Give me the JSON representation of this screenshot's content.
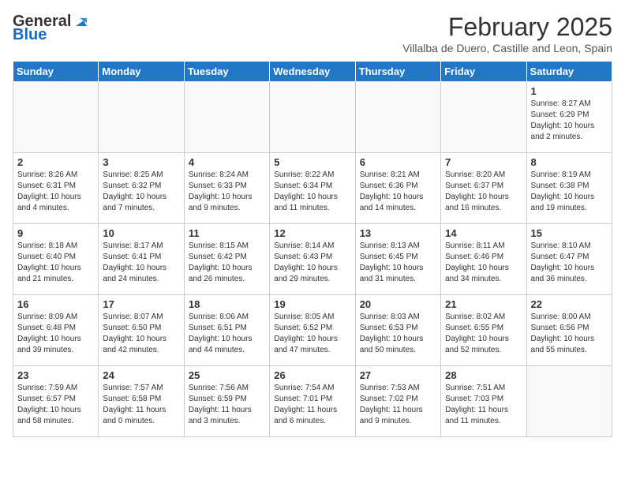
{
  "logo": {
    "general": "General",
    "blue": "Blue"
  },
  "header": {
    "title": "February 2025",
    "subtitle": "Villalba de Duero, Castille and Leon, Spain"
  },
  "weekdays": [
    "Sunday",
    "Monday",
    "Tuesday",
    "Wednesday",
    "Thursday",
    "Friday",
    "Saturday"
  ],
  "weeks": [
    [
      {
        "day": "",
        "info": ""
      },
      {
        "day": "",
        "info": ""
      },
      {
        "day": "",
        "info": ""
      },
      {
        "day": "",
        "info": ""
      },
      {
        "day": "",
        "info": ""
      },
      {
        "day": "",
        "info": ""
      },
      {
        "day": "1",
        "info": "Sunrise: 8:27 AM\nSunset: 6:29 PM\nDaylight: 10 hours\nand 2 minutes."
      }
    ],
    [
      {
        "day": "2",
        "info": "Sunrise: 8:26 AM\nSunset: 6:31 PM\nDaylight: 10 hours\nand 4 minutes."
      },
      {
        "day": "3",
        "info": "Sunrise: 8:25 AM\nSunset: 6:32 PM\nDaylight: 10 hours\nand 7 minutes."
      },
      {
        "day": "4",
        "info": "Sunrise: 8:24 AM\nSunset: 6:33 PM\nDaylight: 10 hours\nand 9 minutes."
      },
      {
        "day": "5",
        "info": "Sunrise: 8:22 AM\nSunset: 6:34 PM\nDaylight: 10 hours\nand 11 minutes."
      },
      {
        "day": "6",
        "info": "Sunrise: 8:21 AM\nSunset: 6:36 PM\nDaylight: 10 hours\nand 14 minutes."
      },
      {
        "day": "7",
        "info": "Sunrise: 8:20 AM\nSunset: 6:37 PM\nDaylight: 10 hours\nand 16 minutes."
      },
      {
        "day": "8",
        "info": "Sunrise: 8:19 AM\nSunset: 6:38 PM\nDaylight: 10 hours\nand 19 minutes."
      }
    ],
    [
      {
        "day": "9",
        "info": "Sunrise: 8:18 AM\nSunset: 6:40 PM\nDaylight: 10 hours\nand 21 minutes."
      },
      {
        "day": "10",
        "info": "Sunrise: 8:17 AM\nSunset: 6:41 PM\nDaylight: 10 hours\nand 24 minutes."
      },
      {
        "day": "11",
        "info": "Sunrise: 8:15 AM\nSunset: 6:42 PM\nDaylight: 10 hours\nand 26 minutes."
      },
      {
        "day": "12",
        "info": "Sunrise: 8:14 AM\nSunset: 6:43 PM\nDaylight: 10 hours\nand 29 minutes."
      },
      {
        "day": "13",
        "info": "Sunrise: 8:13 AM\nSunset: 6:45 PM\nDaylight: 10 hours\nand 31 minutes."
      },
      {
        "day": "14",
        "info": "Sunrise: 8:11 AM\nSunset: 6:46 PM\nDaylight: 10 hours\nand 34 minutes."
      },
      {
        "day": "15",
        "info": "Sunrise: 8:10 AM\nSunset: 6:47 PM\nDaylight: 10 hours\nand 36 minutes."
      }
    ],
    [
      {
        "day": "16",
        "info": "Sunrise: 8:09 AM\nSunset: 6:48 PM\nDaylight: 10 hours\nand 39 minutes."
      },
      {
        "day": "17",
        "info": "Sunrise: 8:07 AM\nSunset: 6:50 PM\nDaylight: 10 hours\nand 42 minutes."
      },
      {
        "day": "18",
        "info": "Sunrise: 8:06 AM\nSunset: 6:51 PM\nDaylight: 10 hours\nand 44 minutes."
      },
      {
        "day": "19",
        "info": "Sunrise: 8:05 AM\nSunset: 6:52 PM\nDaylight: 10 hours\nand 47 minutes."
      },
      {
        "day": "20",
        "info": "Sunrise: 8:03 AM\nSunset: 6:53 PM\nDaylight: 10 hours\nand 50 minutes."
      },
      {
        "day": "21",
        "info": "Sunrise: 8:02 AM\nSunset: 6:55 PM\nDaylight: 10 hours\nand 52 minutes."
      },
      {
        "day": "22",
        "info": "Sunrise: 8:00 AM\nSunset: 6:56 PM\nDaylight: 10 hours\nand 55 minutes."
      }
    ],
    [
      {
        "day": "23",
        "info": "Sunrise: 7:59 AM\nSunset: 6:57 PM\nDaylight: 10 hours\nand 58 minutes."
      },
      {
        "day": "24",
        "info": "Sunrise: 7:57 AM\nSunset: 6:58 PM\nDaylight: 11 hours\nand 0 minutes."
      },
      {
        "day": "25",
        "info": "Sunrise: 7:56 AM\nSunset: 6:59 PM\nDaylight: 11 hours\nand 3 minutes."
      },
      {
        "day": "26",
        "info": "Sunrise: 7:54 AM\nSunset: 7:01 PM\nDaylight: 11 hours\nand 6 minutes."
      },
      {
        "day": "27",
        "info": "Sunrise: 7:53 AM\nSunset: 7:02 PM\nDaylight: 11 hours\nand 9 minutes."
      },
      {
        "day": "28",
        "info": "Sunrise: 7:51 AM\nSunset: 7:03 PM\nDaylight: 11 hours\nand 11 minutes."
      },
      {
        "day": "",
        "info": ""
      }
    ]
  ]
}
